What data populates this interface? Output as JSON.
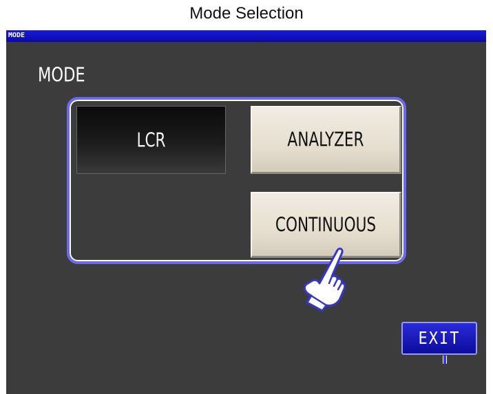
{
  "caption": {
    "title": "Mode Selection"
  },
  "header": {
    "label": "MODE"
  },
  "section": {
    "label": "MODE"
  },
  "modes": {
    "lcr": {
      "label": "LCR",
      "selected": true
    },
    "analyzer": {
      "label": "ANALYZER",
      "selected": false
    },
    "continuous": {
      "label": "CONTINUOUS",
      "selected": false
    }
  },
  "exit": {
    "label": "EXIT"
  },
  "icons": {
    "pointer": "pointing-hand-icon"
  },
  "colors": {
    "screen_bg": "#3c3c3c",
    "header_bar": "#0f0fc0",
    "panel_border": "#6a6aee",
    "button_face": "#e6dfd0",
    "selected_button": "#111111",
    "exit_button": "#1818c0"
  }
}
